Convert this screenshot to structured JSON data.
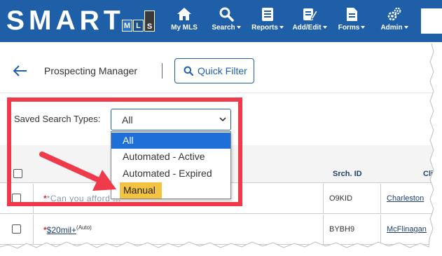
{
  "app": {
    "logo_text": "SMART",
    "logo_tiles": [
      "M",
      "L",
      "S"
    ]
  },
  "nav": [
    {
      "label": "My MLS",
      "icon": "home-icon",
      "caret": false
    },
    {
      "label": "Search",
      "icon": "magnifier-icon",
      "caret": true
    },
    {
      "label": "Reports",
      "icon": "clipboard-icon",
      "caret": true
    },
    {
      "label": "Add/Edit",
      "icon": "edit-icon",
      "caret": true
    },
    {
      "label": "Forms",
      "icon": "document-icon",
      "caret": true
    },
    {
      "label": "Admin",
      "icon": "gears-icon",
      "caret": true
    }
  ],
  "header": {
    "title": "Prospecting Manager",
    "quick_filter_label": "Quick Filter"
  },
  "saved_search": {
    "label": "Saved Search Types:",
    "selected": "All",
    "options": [
      "All",
      "Automated - Active",
      "Automated - Expired",
      "Manual"
    ]
  },
  "table": {
    "columns": [
      "Srch. ID",
      "Cli"
    ],
    "rows": [
      {
        "star": "*",
        "name": "*Can you afford ...",
        "suffix": "",
        "srch_id": "O9KID",
        "client": "Charleston"
      },
      {
        "star": "*",
        "name": "$20mil+",
        "suffix": "(Auto)",
        "srch_id": "BYBH9",
        "client": "McFlinagan"
      }
    ]
  },
  "colors": {
    "brand_blue": "#1f5fa8",
    "annotation_red": "#ee3a4a",
    "highlight_yellow": "#f5c342",
    "selected_blue": "#1f6fd8"
  }
}
